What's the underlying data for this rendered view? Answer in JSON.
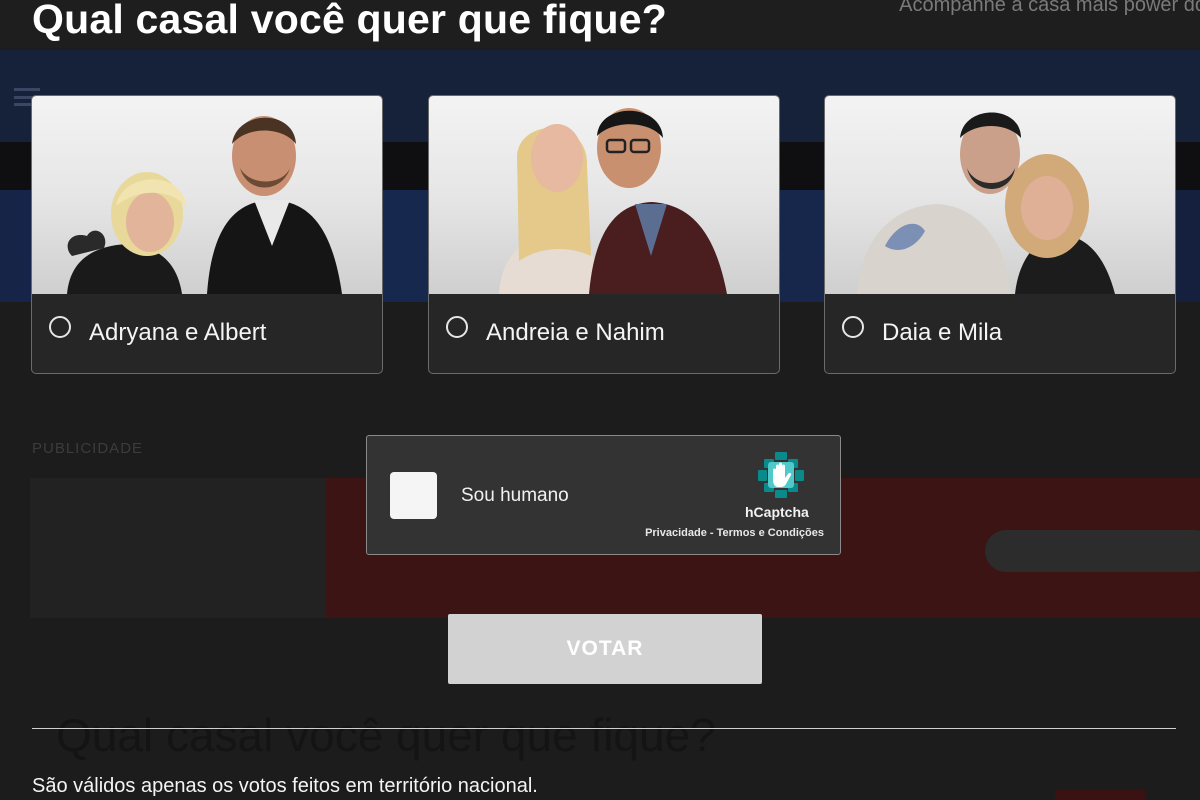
{
  "poll": {
    "title": "Qual casal você quer que fique?",
    "options": [
      {
        "label": "Adryana e Albert",
        "selected": false
      },
      {
        "label": "Andreia e Nahim",
        "selected": false
      },
      {
        "label": "Daia e Mila",
        "selected": false
      }
    ],
    "vote_label": "VOTAR"
  },
  "captcha": {
    "checkbox_label": "Sou humano",
    "brand": "hCaptcha",
    "privacy_link": "Privacidade",
    "separator": " - ",
    "terms_link": "Termos e Condições",
    "checked": false
  },
  "background_page": {
    "tagline": "Acompanhe a casa mais power do",
    "ad_label": "PUBLICIDADE",
    "repeated_title": "Qual casal você quer que fique?",
    "note": "São válidos apenas os votos feitos em território nacional."
  },
  "colors": {
    "page_background": "#1c1c1c",
    "card_background": "#262626",
    "card_border": "#6a6a6a",
    "captcha_background": "#333333",
    "vote_button": "#d2d2d2",
    "hcaptcha_teal": "#0a8a8a"
  }
}
